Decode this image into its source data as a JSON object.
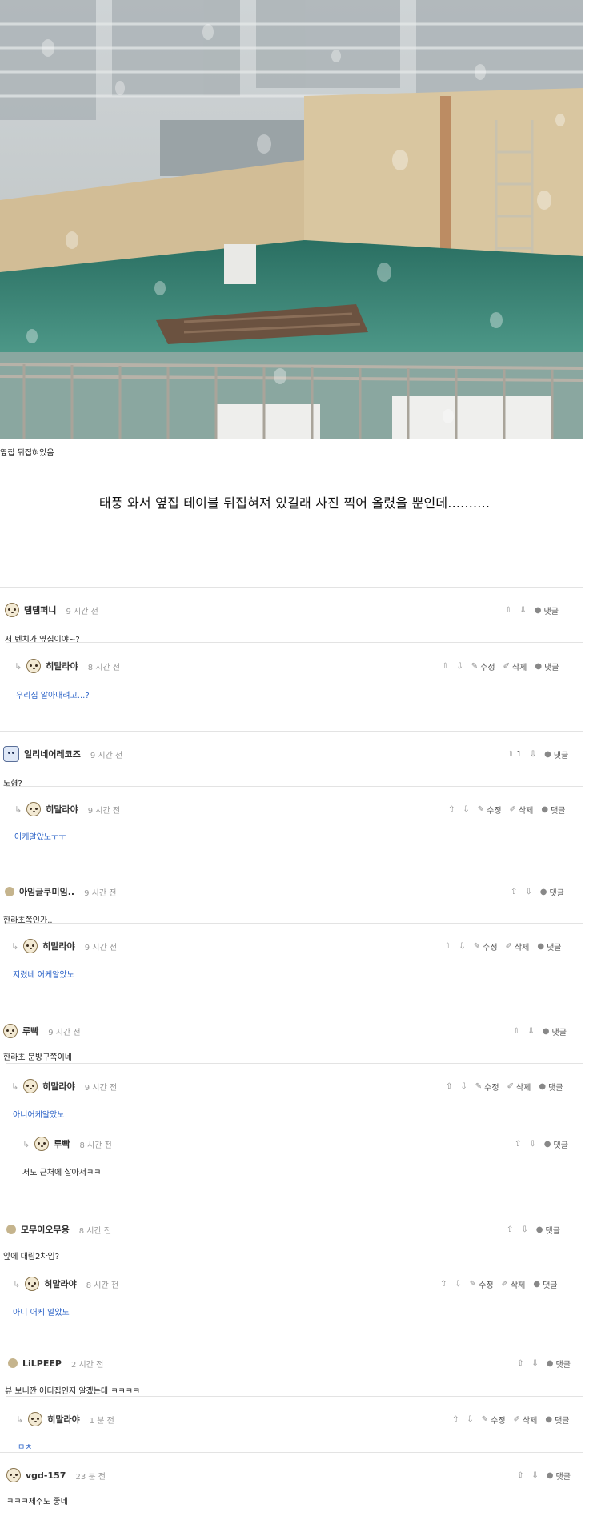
{
  "post": {
    "image_alt": "rain-covered window view of neighbor rooftop with flipped table",
    "caption": "옆집 뒤집혀있음",
    "headline": "태풍 와서 옆집 테이블 뒤집혀져 있길래 사진 찍어 올렸을 뿐인데.........."
  },
  "labels": {
    "edit": "수정",
    "delete": "삭제",
    "reply": "댓글"
  },
  "comments": [
    {
      "nick": "댐댐퍼니",
      "time": "9 시간 전",
      "text": "저 벤치가 옆집이야~?"
    },
    {
      "nick": "히말라야",
      "time": "8 시간 전",
      "text": "우리집 알아내려고...?"
    },
    {
      "nick": "일리네어레코즈",
      "time": "9 시간 전",
      "text": "노형?",
      "likes": "1"
    },
    {
      "nick": "히말라야",
      "time": "9 시간 전",
      "text": "어케알았노ㅜㅜ"
    },
    {
      "nick": "아임글쿠미임..",
      "time": "9 시간 전",
      "text": "한라초쪽인가.."
    },
    {
      "nick": "히말라야",
      "time": "9 시간 전",
      "text": "지렸네 어케알았노"
    },
    {
      "nick": "루빡",
      "time": "9 시간 전",
      "text": "한라초 문방구쪽이네"
    },
    {
      "nick": "히말라야",
      "time": "9 시간 전",
      "text": "아니어케알았노"
    },
    {
      "nick": "루빡",
      "time": "8 시간 전",
      "text": "저도 근처에 살아서ㅋㅋ"
    },
    {
      "nick": "모무이오무용",
      "time": "8 시간 전",
      "text": "앞에 대림2차임?"
    },
    {
      "nick": "히말라야",
      "time": "8 시간 전",
      "text": "아니 어케 알았노"
    },
    {
      "nick": "LiLPEEP",
      "time": "2 시간 전",
      "text": "뷰 보니깐 어디집인지 알겠는데 ㅋㅋㅋㅋ"
    },
    {
      "nick": "히말라야",
      "time": "1 분 전",
      "text": "ㅁㅊ"
    },
    {
      "nick": "vgd-157",
      "time": "23 분 전",
      "text": "ㅋㅋㅋ제주도 좋네"
    }
  ],
  "colors": {
    "reply_text": "#2a62c7",
    "pool": "#2f7a6c",
    "wall": "#d9c6a0"
  }
}
